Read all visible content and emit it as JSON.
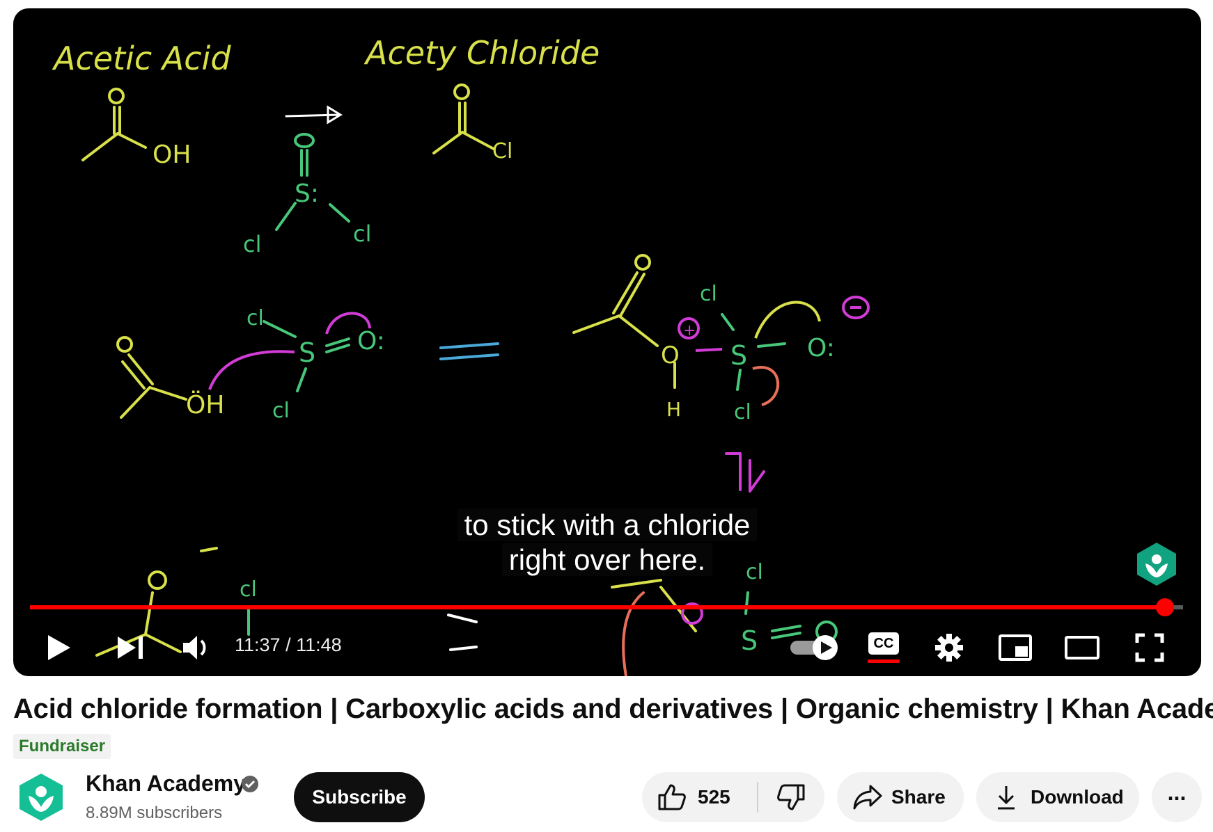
{
  "video": {
    "caption_line1": "to stick with a chloride",
    "caption_line2": "right over here.",
    "time": "11:37 / 11:48",
    "progress": 0.984,
    "board_labels": {
      "acetic_acid": "Acetic Acid",
      "acetyl_chloride": "Acety Chloride"
    }
  },
  "controls": {
    "play_icon": "play-icon",
    "next_icon": "next-icon",
    "volume_icon": "volume-icon",
    "autoplay_icon": "autoplay-toggle-icon",
    "cc_label": "CC",
    "settings_icon": "gear-icon",
    "miniplayer_icon": "miniplayer-icon",
    "theater_icon": "theater-icon",
    "fullscreen_icon": "fullscreen-icon"
  },
  "info": {
    "title": "Acid chloride formation | Carboxylic acids and derivatives | Organic chemistry | Khan Academy",
    "badge": "Fundraiser",
    "channel_name": "Khan Academy",
    "subscribers": "8.89M subscribers",
    "subscribe_label": "Subscribe",
    "likes": "525",
    "share_label": "Share",
    "download_label": "Download",
    "more_label": "..."
  },
  "colors": {
    "progress": "#ff0000",
    "chalk_yellow": "#d8e04a",
    "chalk_green": "#48c77a",
    "chalk_magenta": "#d23cd6",
    "chalk_blue": "#4aa9d9",
    "ka_green": "#14bf96",
    "fundraiser_text": "#2a7a2a"
  }
}
